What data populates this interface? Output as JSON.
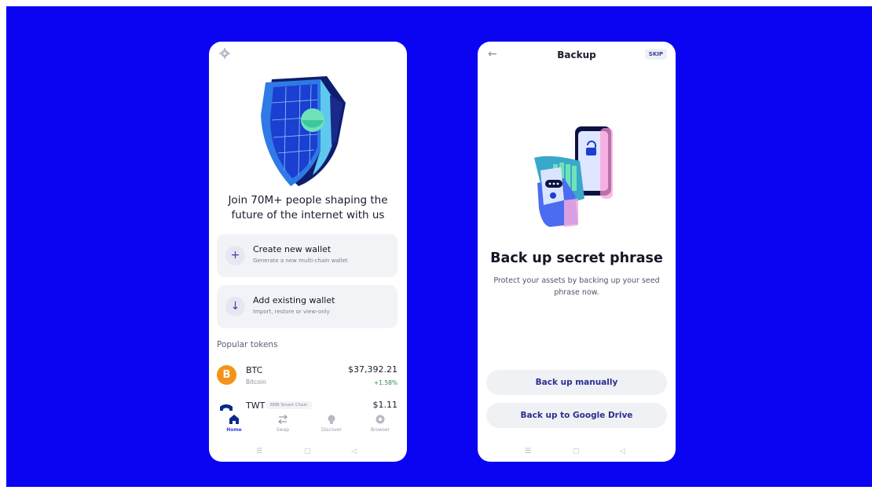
{
  "onboarding": {
    "headline": "Join 70M+ people shaping the future of the internet with us",
    "create_wallet": {
      "title": "Create new wallet",
      "subtitle": "Generate a new multi-chain wallet",
      "icon": "+"
    },
    "add_wallet": {
      "title": "Add existing wallet",
      "subtitle": "Import, restore or view-only",
      "icon": "↓"
    },
    "popular_tokens_label": "Popular tokens",
    "tokens": [
      {
        "symbol": "BTC",
        "name": "Bitcoin",
        "price": "$37,392.21",
        "change": "+1.58%",
        "badge": ""
      },
      {
        "symbol": "TWT",
        "name": "",
        "price": "$1.11",
        "change": "",
        "badge": "BNB Smart Chain"
      }
    ],
    "tabs": [
      {
        "label": "Home",
        "icon": "home-icon",
        "active": true
      },
      {
        "label": "Swap",
        "icon": "swap-icon",
        "active": false
      },
      {
        "label": "Discover",
        "icon": "discover-icon",
        "active": false
      },
      {
        "label": "Browser",
        "icon": "browser-icon",
        "active": false
      }
    ]
  },
  "backup": {
    "title": "Backup",
    "skip_label": "SKIP",
    "heading": "Back up secret phrase",
    "description": "Protect your assets by backing up your seed phrase now.",
    "manual_button": "Back up manually",
    "google_button": "Back up to Google Drive"
  },
  "colors": {
    "background": "#0a04f2",
    "accent": "#2b3fd6",
    "bitcoin": "#f4931a"
  },
  "system_nav": {
    "menu": "☰",
    "home": "▢",
    "back": "◁"
  }
}
